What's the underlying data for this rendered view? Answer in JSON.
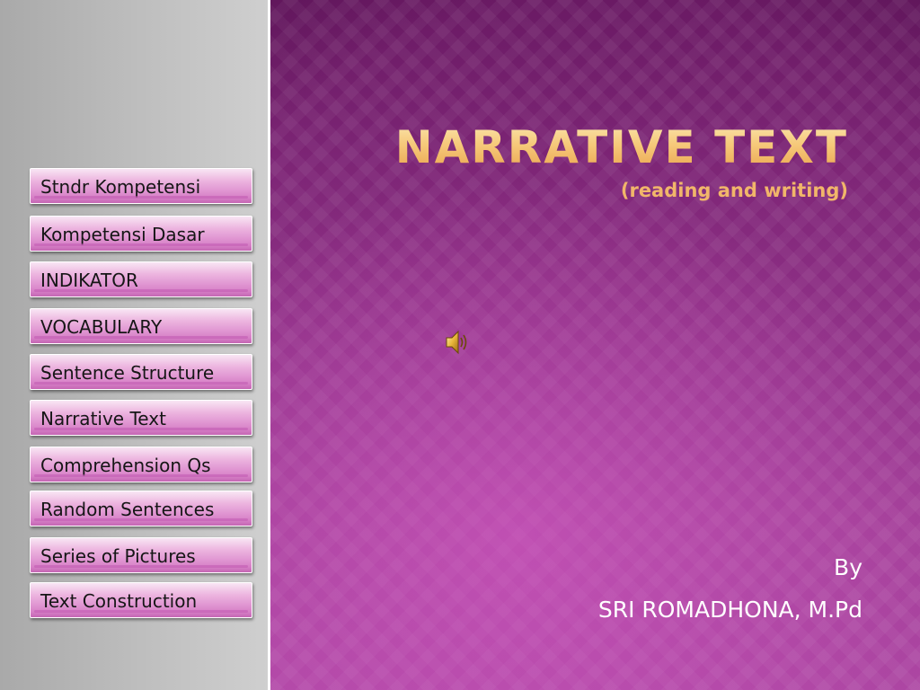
{
  "slide": {
    "title": "Narrative Text",
    "subtitle": "(reading and writing)",
    "byline_label": "By",
    "author": "SRI ROMADHONA, M.Pd"
  },
  "nav": {
    "items": [
      {
        "label": "Stndr Kompetensi"
      },
      {
        "label": "Kompetensi Dasar"
      },
      {
        "label": "INDIKATOR"
      },
      {
        "label": "VOCABULARY"
      },
      {
        "label": "Sentence Structure"
      },
      {
        "label": "Narrative Text"
      },
      {
        "label": "Comprehension Qs"
      },
      {
        "label": "Random Sentences"
      },
      {
        "label": "Series of Pictures"
      },
      {
        "label": "Text Construction"
      }
    ]
  },
  "icons": {
    "audio": "speaker-icon"
  },
  "colors": {
    "background": "#8a2d82",
    "title": "#f4c47a",
    "button": "#e29ad4",
    "sidebar": "#bdbdbd"
  }
}
